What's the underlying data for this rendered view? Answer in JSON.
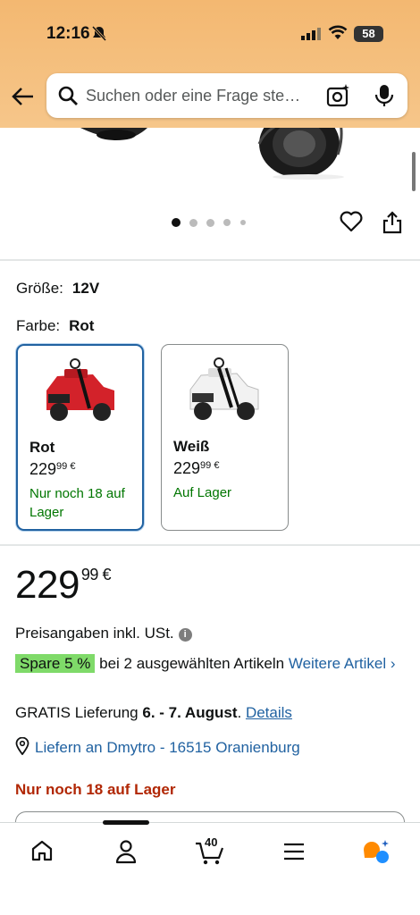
{
  "status_bar": {
    "time": "12:16",
    "battery": "58"
  },
  "search": {
    "placeholder": "Suchen oder eine Frage ste…"
  },
  "carousel": {
    "image_count": 5,
    "active_index": 0
  },
  "options": {
    "size_label": "Größe:",
    "size_value": "12V",
    "color_label": "Farbe:",
    "color_value": "Rot",
    "swatches": [
      {
        "name": "Rot",
        "price_main": "229",
        "price_frac": "99 €",
        "stock": "Nur noch 18 auf Lager",
        "car_color": "#d3222a",
        "selected": true
      },
      {
        "name": "Weiß",
        "price_main": "229",
        "price_frac": "99 €",
        "stock": "Auf Lager",
        "car_color": "#f2f2f2",
        "selected": false
      }
    ]
  },
  "price": {
    "main": "229",
    "fraction": "99 €"
  },
  "tax_text": "Preisangaben inkl. USt.",
  "promo": {
    "badge": "Spare 5 %",
    "text": "bei 2 ausgewählten Artikeln",
    "link": "Weitere Artikel ›"
  },
  "delivery": {
    "prefix": "GRATIS Lieferung",
    "dates": "6. - 7. August",
    "suffix": ".",
    "link": "Details"
  },
  "deliver_to": "Liefern an Dmytro - 16515 Oranienburg",
  "stock_warning": "Nur noch 18 auf Lager",
  "tabbar": {
    "cart_count": "40"
  },
  "colors": {
    "link": "#2162a1",
    "green": "#007600",
    "red": "#b12704",
    "header": "#f5c07a",
    "selected_border": "#2162a1"
  }
}
